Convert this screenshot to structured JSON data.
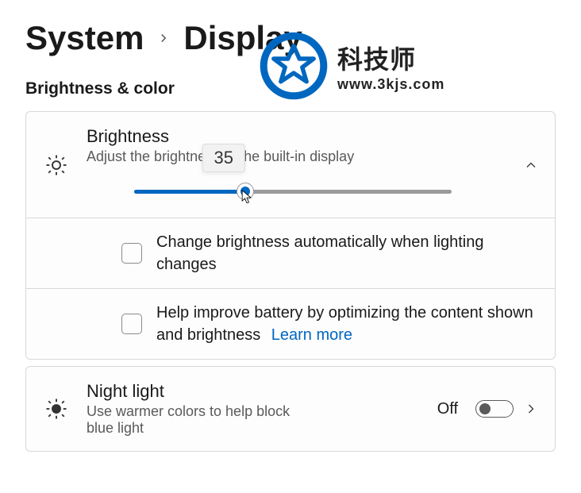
{
  "breadcrumb": {
    "root": "System",
    "current": "Display"
  },
  "section_title": "Brightness & color",
  "brightness": {
    "title": "Brightness",
    "subtitle": "Adjust the brightness of the built-in display",
    "value": "35",
    "percent": 35
  },
  "options": {
    "auto_brightness": "Change brightness automatically when lighting changes",
    "battery_optimize": "Help improve battery by optimizing the content shown and brightness",
    "learn_more": "Learn more"
  },
  "nightlight": {
    "title": "Night light",
    "subtitle": "Use warmer colors to help block blue light",
    "state": "Off"
  },
  "watermark": {
    "main": "科技师",
    "sub": "www.3kjs.com"
  }
}
